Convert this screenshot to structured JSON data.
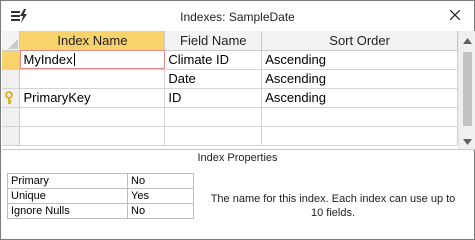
{
  "window": {
    "title": "Indexes: SampleDate",
    "icon": "index-lightning-icon",
    "close_icon": "close-icon"
  },
  "grid": {
    "columns": [
      "Index Name",
      "Field Name",
      "Sort Order"
    ],
    "active_column": 0,
    "rows": [
      {
        "marker": "",
        "index_name": "MyIndex",
        "field_name": "Climate ID",
        "sort_order": "Ascending"
      },
      {
        "marker": "",
        "index_name": "",
        "field_name": "Date",
        "sort_order": "Ascending"
      },
      {
        "marker": "primary-key-icon",
        "index_name": "PrimaryKey",
        "field_name": "ID",
        "sort_order": "Ascending"
      },
      {
        "marker": "",
        "index_name": "",
        "field_name": "",
        "sort_order": ""
      },
      {
        "marker": "",
        "index_name": "",
        "field_name": "",
        "sort_order": ""
      }
    ]
  },
  "properties": {
    "title": "Index Properties",
    "items": [
      {
        "label": "Primary",
        "value": "No"
      },
      {
        "label": "Unique",
        "value": "Yes"
      },
      {
        "label": "Ignore Nulls",
        "value": "No"
      }
    ],
    "help_text": "The name for this index.  Each index can use up to 10 fields."
  },
  "colors": {
    "active_header": "#f8d26a",
    "key_icon": "#d9a700"
  }
}
